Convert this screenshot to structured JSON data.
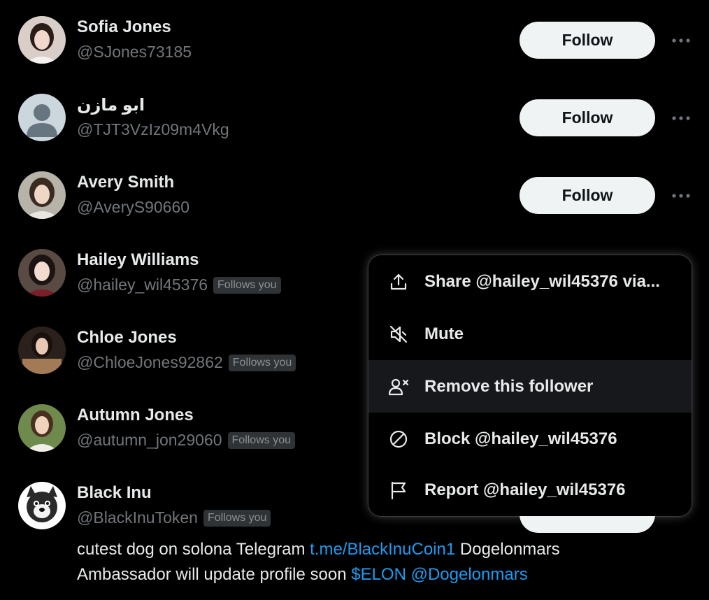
{
  "users": [
    {
      "name": "Sofia Jones",
      "handle": "@SJones73185",
      "follows_you": "",
      "button": "Follow"
    },
    {
      "name": "ابو مازن",
      "handle": "@TJT3VzIz09m4Vkg",
      "follows_you": "",
      "button": "Follow"
    },
    {
      "name": "Avery Smith",
      "handle": "@AveryS90660",
      "follows_you": "",
      "button": "Follow"
    },
    {
      "name": "Hailey Williams",
      "handle": "@hailey_wil45376",
      "follows_you": "Follows you"
    },
    {
      "name": "Chloe Jones",
      "handle": "@ChloeJones92862",
      "follows_you": "Follows you"
    },
    {
      "name": "Autumn Jones",
      "handle": "@autumn_jon29060",
      "follows_you": "Follows you"
    },
    {
      "name": "Black Inu",
      "handle": "@BlackInuToken",
      "follows_you": "Follows you"
    }
  ],
  "bio": {
    "text1": "cutest dog on solona Telegram ",
    "link1": "t.me/BlackInuCoin1",
    "text2": " Dogelonmars Ambassador will update profile soon ",
    "link2": "$ELON",
    "text3": " ",
    "link3": "@Dogelonmars"
  },
  "menu": {
    "items": [
      {
        "label": "Share @hailey_wil45376 via...",
        "icon": "share-icon"
      },
      {
        "label": "Mute",
        "icon": "mute-icon"
      },
      {
        "label": "Remove this follower",
        "icon": "remove-follower-icon"
      },
      {
        "label": "Block @hailey_wil45376",
        "icon": "block-icon"
      },
      {
        "label": "Report @hailey_wil45376",
        "icon": "flag-icon"
      }
    ]
  },
  "colors": {
    "background": "#000000",
    "text": "#e7e9ea",
    "muted": "#71767b",
    "link": "#1d9bf0",
    "button_bg": "#eff3f4"
  }
}
